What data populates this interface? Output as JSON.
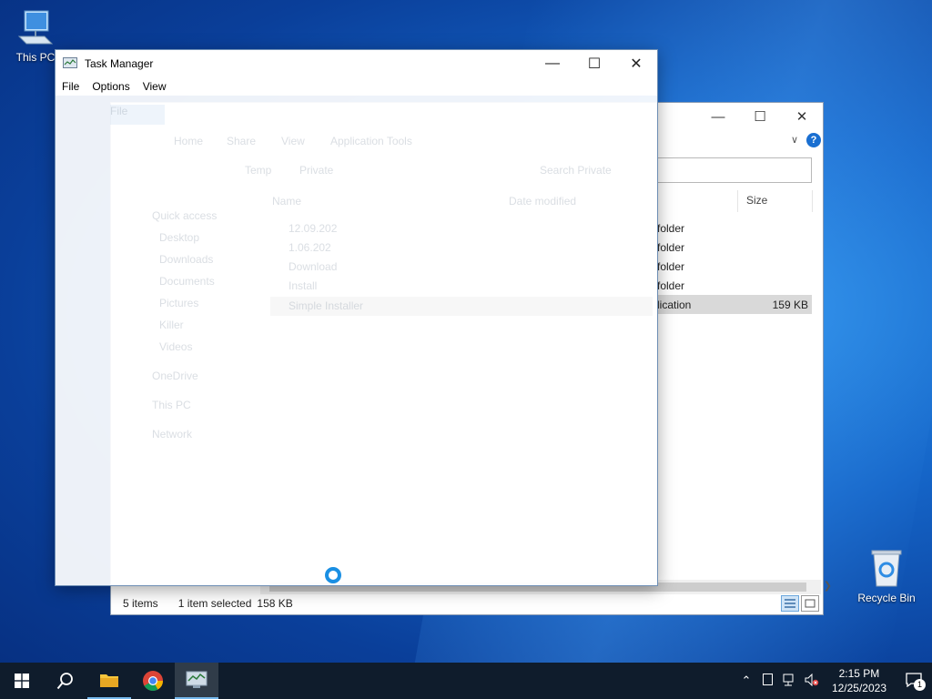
{
  "desktop": {
    "icons": [
      {
        "label": "This PC"
      },
      {
        "label": "Recycle Bin"
      }
    ]
  },
  "explorer": {
    "columns": {
      "size": "Size"
    },
    "rows": [
      {
        "type": "folder",
        "size": ""
      },
      {
        "type": "folder",
        "size": ""
      },
      {
        "type": "folder",
        "size": ""
      },
      {
        "type": "folder",
        "size": ""
      },
      {
        "type": "lication",
        "size": "159 KB"
      }
    ],
    "status": {
      "items": "5 items",
      "selected": "1 item selected",
      "selected_size": "158 KB"
    }
  },
  "taskmgr": {
    "title": "Task Manager",
    "menu": [
      "File",
      "Options",
      "View"
    ],
    "ghost": {
      "tabs": [
        "File",
        "Home",
        "Share",
        "View",
        "Application Tools"
      ],
      "path": [
        "Temp",
        "Private"
      ],
      "search": "Search Private",
      "header_name": "Name",
      "header_date": "Date modified",
      "nav": [
        "Quick access",
        "Desktop",
        "Downloads",
        "Documents",
        "Pictures",
        "Killer",
        "Videos",
        "OneDrive",
        "This PC",
        "Network"
      ],
      "files": [
        "12.09.202",
        "1.06.202",
        "Download",
        "Install",
        "Simple Installer"
      ]
    }
  },
  "taskbar": {
    "time": "2:15 PM",
    "date": "12/25/2023",
    "notification_count": "1"
  }
}
